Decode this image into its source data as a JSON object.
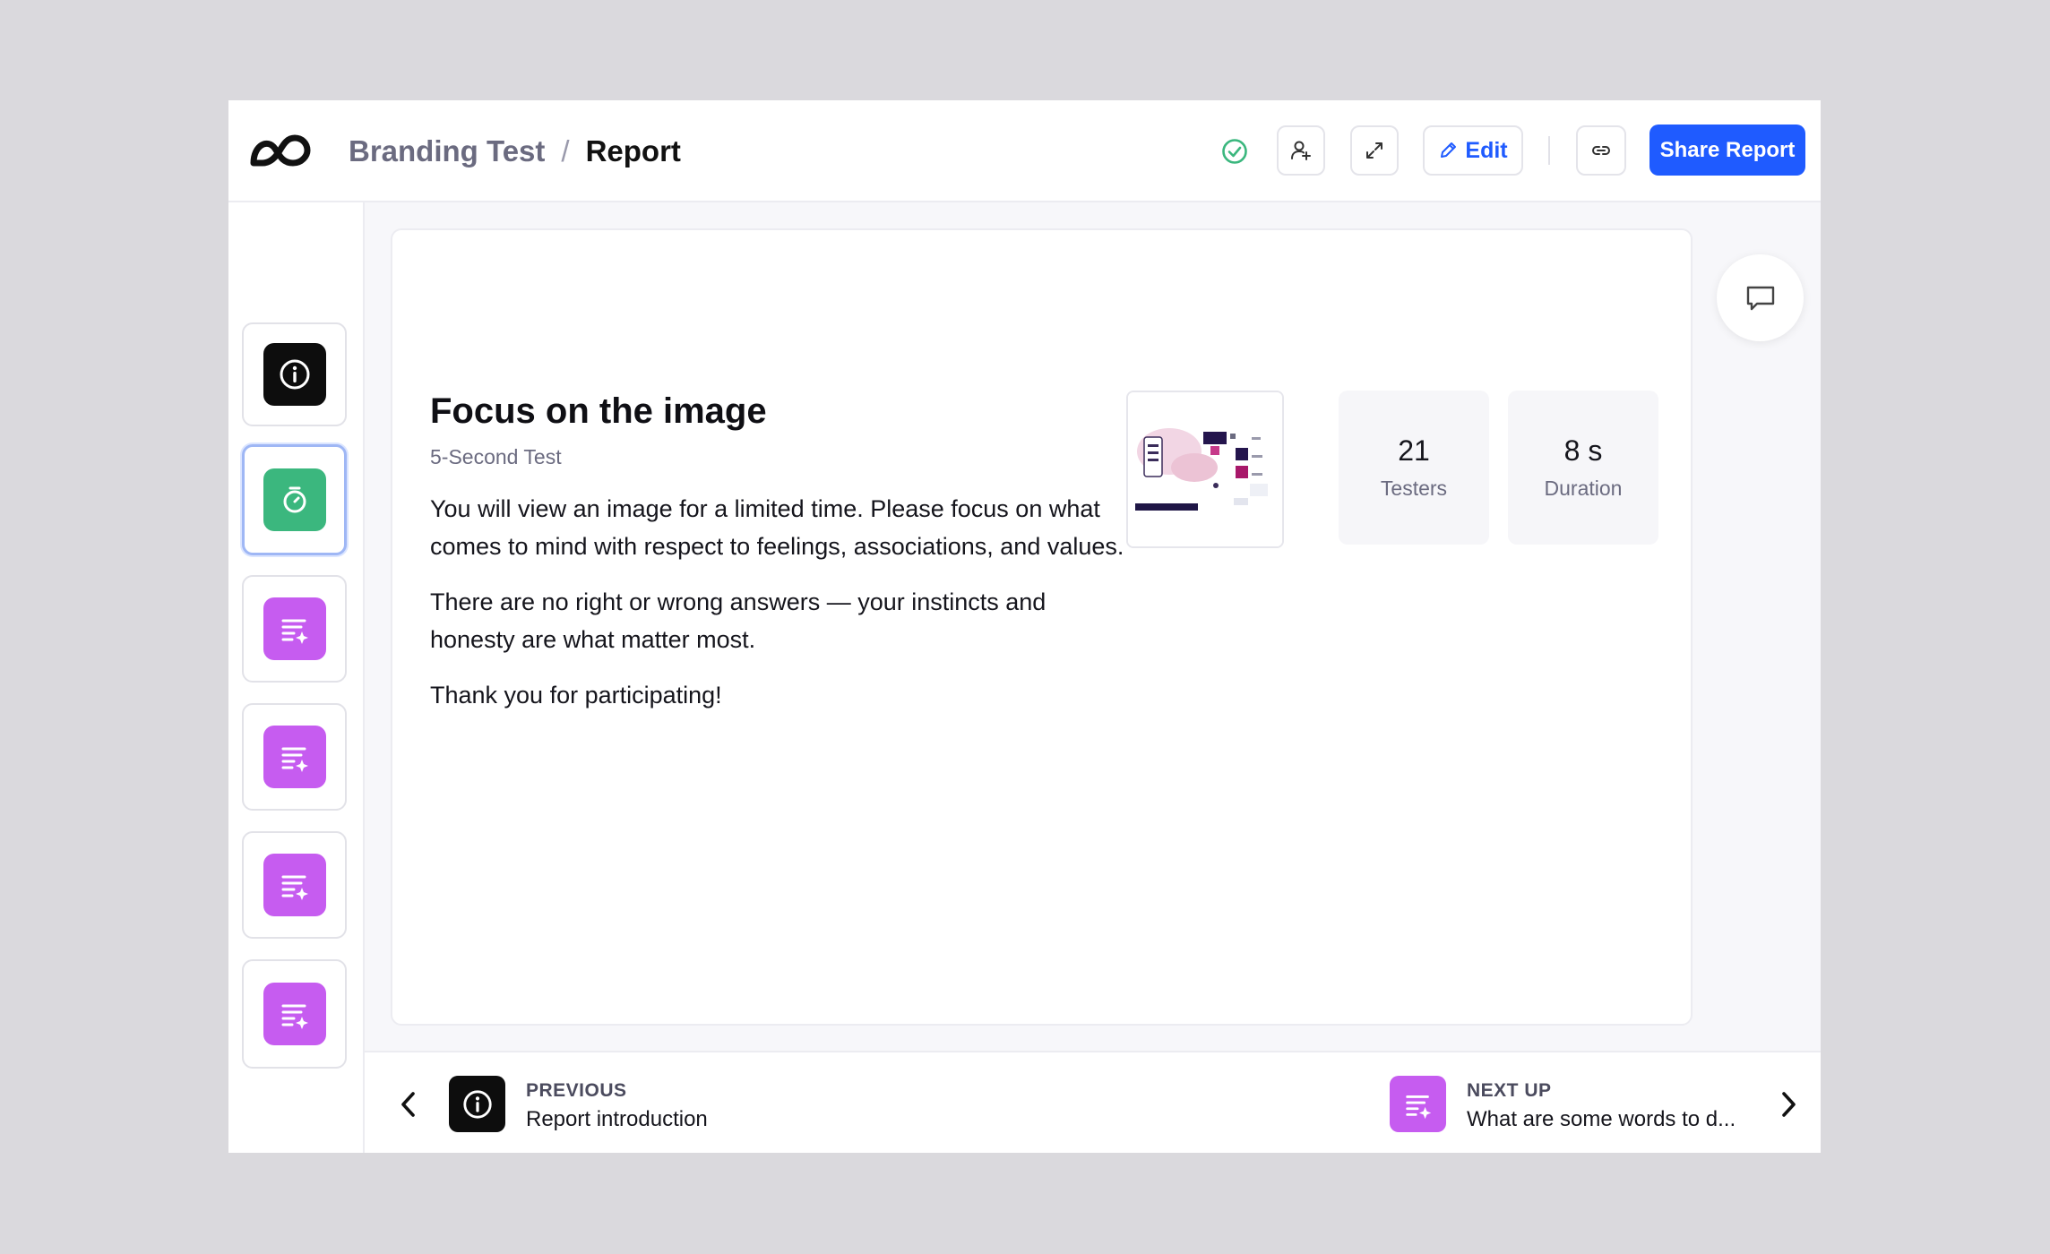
{
  "header": {
    "breadcrumb_parent": "Branding Test",
    "breadcrumb_separator": "/",
    "breadcrumb_current": "Report",
    "edit_label": "Edit",
    "share_label": "Share Report"
  },
  "rail": {
    "items": [
      {
        "icon": "info-icon",
        "color": "#0d0d0d"
      },
      {
        "icon": "timer-icon",
        "color": "#3bb77e",
        "selected": true
      },
      {
        "icon": "text-question-icon",
        "color": "#c65cf0"
      },
      {
        "icon": "text-question-icon",
        "color": "#c65cf0"
      },
      {
        "icon": "text-question-icon",
        "color": "#c65cf0"
      },
      {
        "icon": "text-question-icon",
        "color": "#c65cf0"
      }
    ]
  },
  "content": {
    "title": "Focus on the image",
    "subtitle": "5-Second Test",
    "paragraphs": [
      "You will view an image for a limited time. Please focus on what comes to mind with respect to feelings, associations, and values.",
      "There are no right or wrong answers — your instincts and honesty are what matter most.",
      "Thank you for participating!"
    ],
    "stats": [
      {
        "value": "21",
        "label": "Testers"
      },
      {
        "value": "8 s",
        "label": "Duration"
      }
    ]
  },
  "footer": {
    "previous_label": "PREVIOUS",
    "previous_text": "Report introduction",
    "next_label": "NEXT UP",
    "next_text": "What are some words to d..."
  },
  "colors": {
    "accent": "#1f5bff",
    "success": "#3bb77e",
    "question": "#c65cf0"
  }
}
